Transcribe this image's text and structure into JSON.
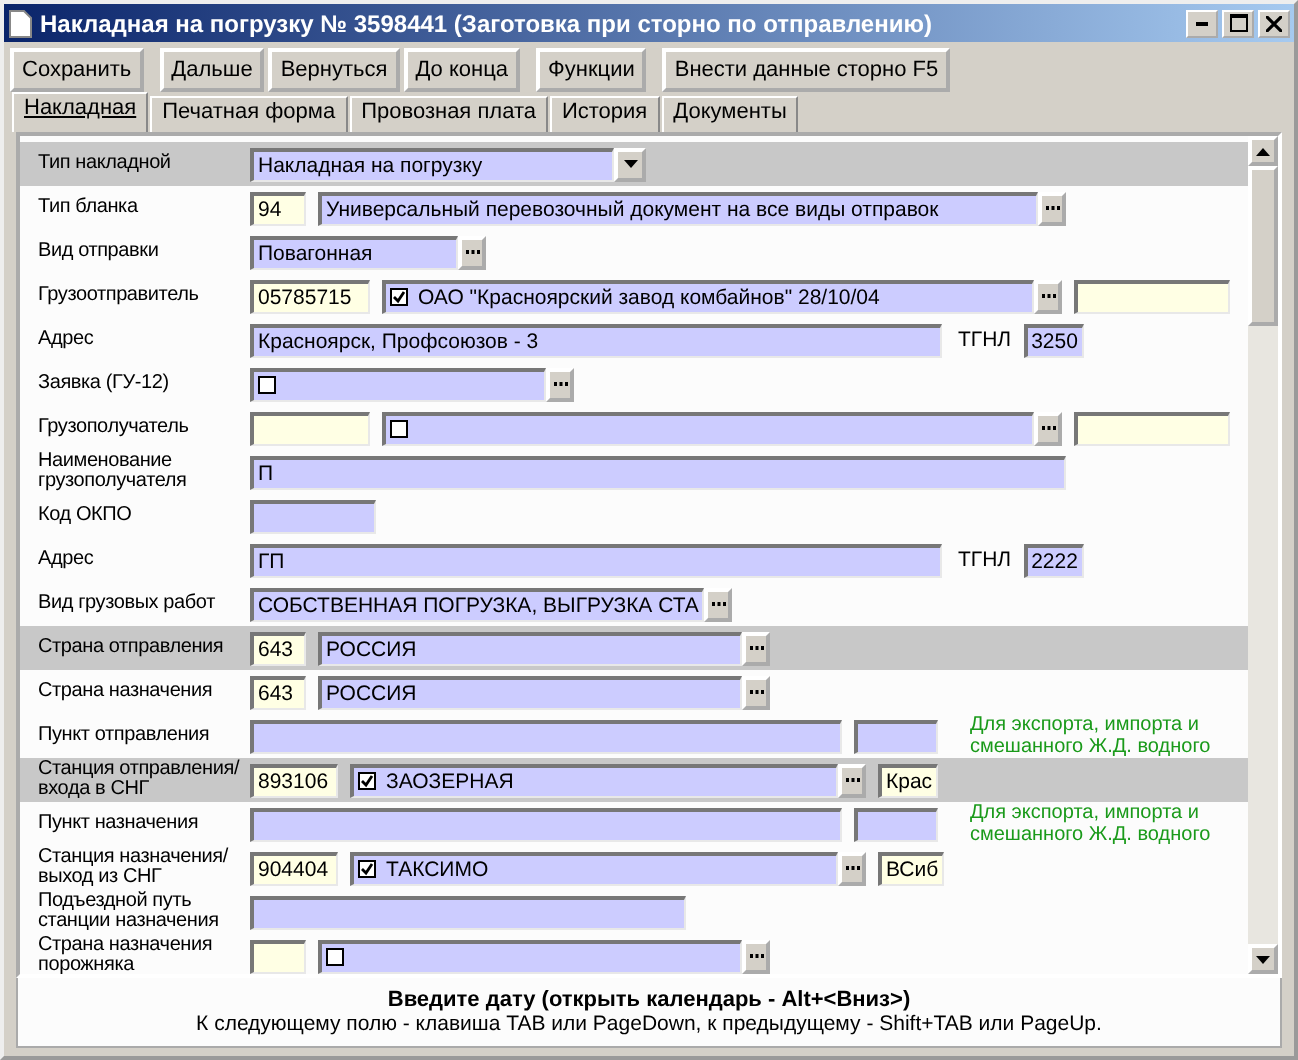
{
  "window": {
    "title": "Накладная на погрузку № 3598441 (Заготовка при сторно по отправлению)"
  },
  "toolbar": [
    [
      "Сохранить"
    ],
    [
      "Дальше",
      "Вернуться",
      "До конца"
    ],
    [
      "Функции"
    ],
    [
      "Внести данные сторно F5"
    ]
  ],
  "tabs": [
    {
      "label": "Накладная",
      "selected": true
    },
    {
      "label": "Печатная форма",
      "selected": false
    },
    {
      "label": "Провозная плата",
      "selected": false
    },
    {
      "label": "История",
      "selected": false
    },
    {
      "label": "Документы",
      "selected": false
    }
  ],
  "rows": [
    {
      "label": "Тип накладной",
      "highlighted": true,
      "parts": [
        {
          "kind": "select",
          "value": "Накладная на погрузку"
        }
      ]
    },
    {
      "label": "Тип бланка",
      "highlighted": false,
      "parts": [
        {
          "kind": "code",
          "value": "94"
        },
        {
          "kind": "picker",
          "value": "Универсальный перевозочный документ на все виды отправок"
        }
      ]
    },
    {
      "label": "Вид отправки",
      "highlighted": false,
      "parts": [
        {
          "kind": "picker",
          "value": "Повагонная"
        }
      ]
    },
    {
      "label": "Грузоотправитель",
      "highlighted": false,
      "parts": [
        {
          "kind": "code",
          "value": "05785715"
        },
        {
          "kind": "picker",
          "checked": true,
          "value": "ОАО \"Красноярский завод комбайнов\"  28/10/04"
        },
        {
          "kind": "code"
        }
      ]
    },
    {
      "label": "Адрес",
      "highlighted": false,
      "parts": [
        {
          "kind": "field",
          "value": "Красноярск, Профсоюзов - 3"
        },
        {
          "kind": "tag",
          "value": "ТГНЛ"
        },
        {
          "kind": "field",
          "value": "3250"
        }
      ]
    },
    {
      "label": "Заявка (ГУ-12)",
      "highlighted": false,
      "parts": [
        {
          "kind": "picker",
          "checked": false
        }
      ]
    },
    {
      "label": "Грузополучатель",
      "highlighted": false,
      "parts": [
        {
          "kind": "code"
        },
        {
          "kind": "picker",
          "checked": false
        },
        {
          "kind": "code"
        }
      ]
    },
    {
      "label": "Наименование грузополучателя",
      "highlighted": false,
      "parts": [
        {
          "kind": "field",
          "value": "П"
        }
      ]
    },
    {
      "label": "Код ОКПО",
      "highlighted": false,
      "parts": [
        {
          "kind": "field"
        }
      ]
    },
    {
      "label": "Адрес",
      "highlighted": false,
      "parts": [
        {
          "kind": "field",
          "value": "ГП"
        },
        {
          "kind": "tag",
          "value": "ТГНЛ"
        },
        {
          "kind": "field",
          "value": "2222"
        }
      ]
    },
    {
      "label": "Вид грузовых работ",
      "highlighted": false,
      "parts": [
        {
          "kind": "picker",
          "value": "СОБСТВЕННАЯ ПОГРУЗКА, ВЫГРУЗКА СТА"
        }
      ]
    },
    {
      "label": "Страна отправления",
      "highlighted": true,
      "parts": [
        {
          "kind": "code",
          "value": "643"
        },
        {
          "kind": "picker",
          "value": "РОССИЯ"
        }
      ]
    },
    {
      "label": "Страна назначения",
      "highlighted": false,
      "parts": [
        {
          "kind": "code",
          "value": "643"
        },
        {
          "kind": "picker",
          "value": "РОССИЯ"
        }
      ]
    },
    {
      "label": "Пункт отправления",
      "highlighted": false,
      "parts": [
        {
          "kind": "field"
        },
        {
          "kind": "field"
        },
        {
          "kind": "note",
          "value": "Для экспорта, импорта и смешанного Ж.Д. водного"
        }
      ]
    },
    {
      "label": "Станция отправления/ входа в СНГ",
      "highlighted": true,
      "parts": [
        {
          "kind": "code",
          "value": "893106"
        },
        {
          "kind": "picker",
          "checked": true,
          "value": "ЗАОЗЕРНАЯ"
        },
        {
          "kind": "code",
          "value": "Крас"
        }
      ]
    },
    {
      "label": "Пункт назначения",
      "highlighted": false,
      "parts": [
        {
          "kind": "field"
        },
        {
          "kind": "field"
        },
        {
          "kind": "note",
          "value": "Для экспорта, импорта и смешанного Ж.Д. водного"
        }
      ]
    },
    {
      "label": "Станция назначения/ выход из СНГ",
      "highlighted": false,
      "parts": [
        {
          "kind": "code",
          "value": "904404"
        },
        {
          "kind": "picker",
          "checked": true,
          "value": "ТАКСИМО"
        },
        {
          "kind": "code",
          "value": "ВСиб"
        }
      ]
    },
    {
      "label": "Подъездной путь станции назначения",
      "highlighted": false,
      "parts": [
        {
          "kind": "field"
        }
      ]
    },
    {
      "label": "Страна назначения порожняка",
      "highlighted": false,
      "parts": [
        {
          "kind": "code"
        },
        {
          "kind": "picker",
          "checked": false
        }
      ]
    }
  ],
  "hint": {
    "title": "Введите дату (открыть календарь - Alt+<Вниз>)",
    "text": "К следующему полю - клавиша TAB или PageDown, к предыдущему - Shift+TAB или PageUp."
  }
}
